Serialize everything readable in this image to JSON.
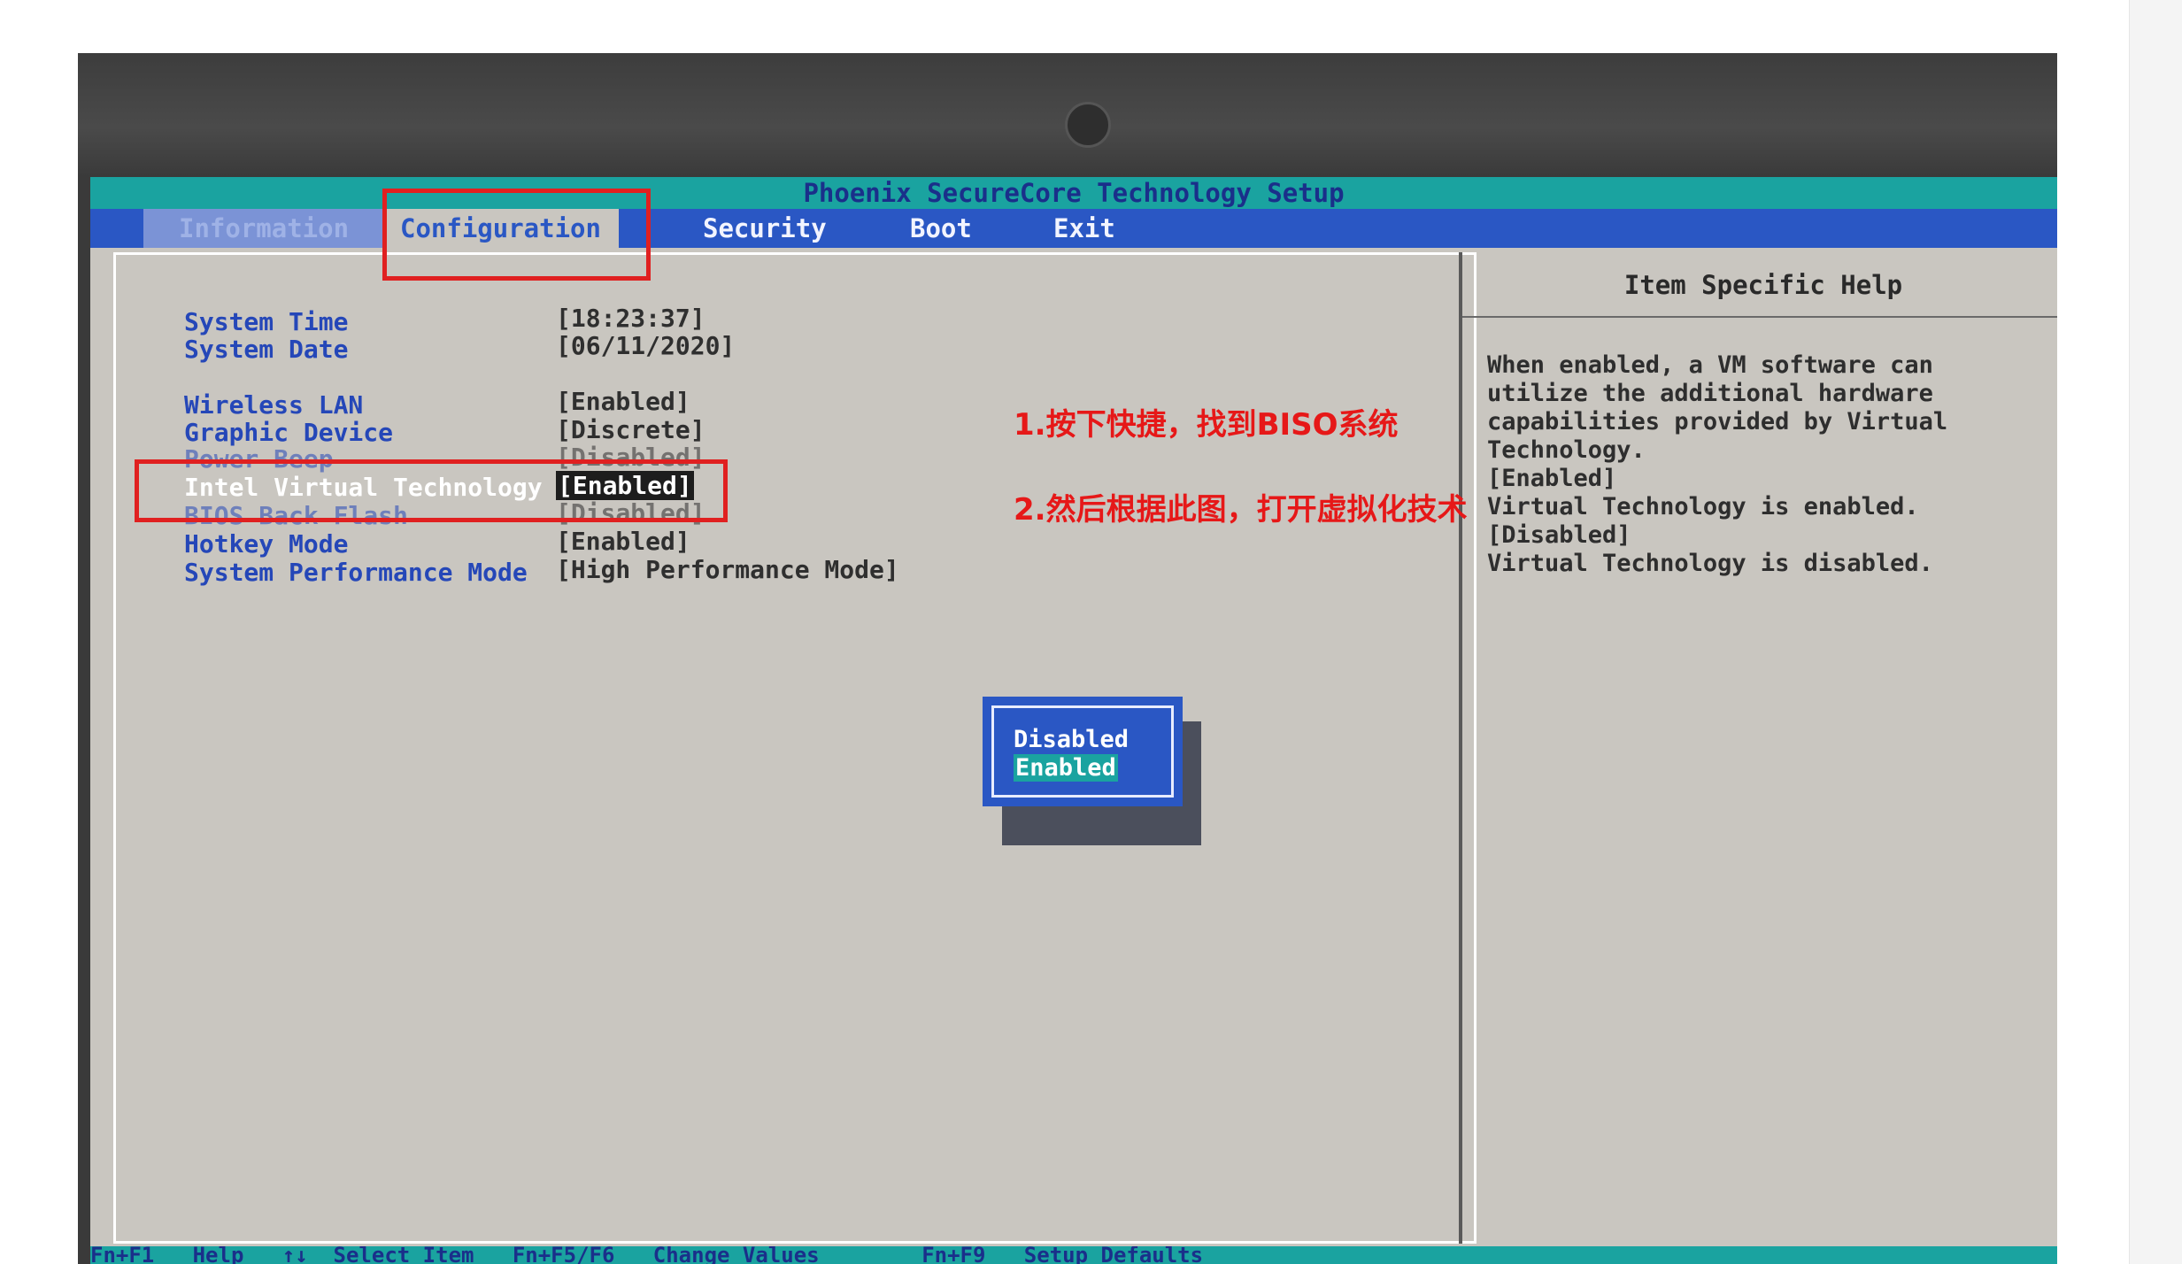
{
  "title": "Phoenix SecureCore Technology Setup",
  "menu": {
    "information": "Information",
    "configuration": "Configuration",
    "security": "Security",
    "boot": "Boot",
    "exit": "Exit"
  },
  "settings": [
    {
      "label": "System Time",
      "value": "[18:23:37]"
    },
    {
      "label": "System Date",
      "value": "[06/11/2020]"
    },
    {
      "label": "Wireless LAN",
      "value": "[Enabled]"
    },
    {
      "label": "Graphic Device",
      "value": "[Discrete]"
    },
    {
      "label": "Power Beep",
      "value": "[Disabled]"
    },
    {
      "label": "Intel Virtual Technology",
      "value": "[Enabled]"
    },
    {
      "label": "BIOS Back Flash",
      "value": "[Disabled]"
    },
    {
      "label": "Hotkey Mode",
      "value": "[Enabled]"
    },
    {
      "label": "System Performance Mode",
      "value": "[High Performance Mode]"
    }
  ],
  "help": {
    "title": "Item Specific Help",
    "lines": [
      "When enabled, a VM software can",
      "utilize the additional hardware",
      "capabilities provided by Virtual",
      "Technology.",
      "[Enabled]",
      "Virtual Technology is enabled.",
      "[Disabled]",
      "Virtual Technology is disabled."
    ]
  },
  "popup": {
    "options": [
      "Disabled",
      "Enabled"
    ],
    "selected": "Enabled"
  },
  "footer": "Fn+F1   Help   ↑↓  Select Item   Fn+F5/F6   Change Values        Fn+F9   Setup Defaults",
  "notes": {
    "step1": "1.按下快捷，找到BISO系统",
    "step2": "2.然后根据此图，打开虚拟化技术"
  },
  "colors": {
    "title_bar": "#1aa3a0",
    "menu_bar": "#2a57c4",
    "annotation_red": "#e02020"
  }
}
